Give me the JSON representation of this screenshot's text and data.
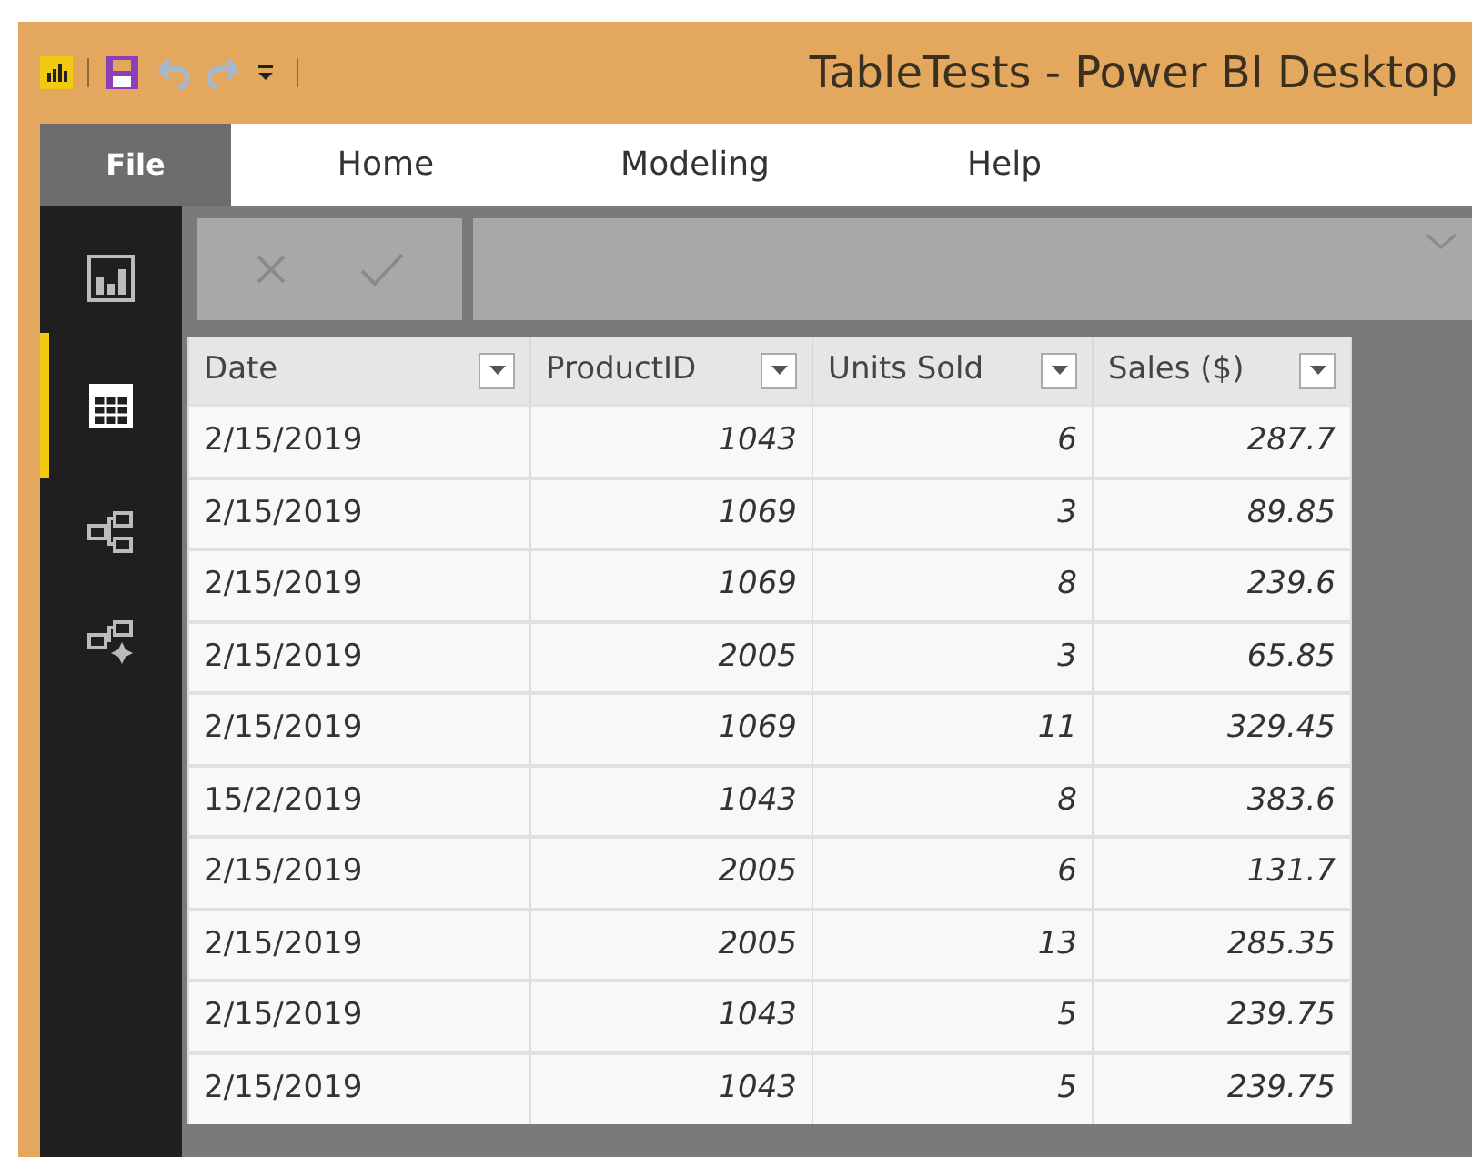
{
  "window": {
    "title": "TableTests - Power BI Desktop"
  },
  "menu": [
    {
      "label": "File",
      "selected": true
    },
    {
      "label": "Home",
      "selected": false
    },
    {
      "label": "Modeling",
      "selected": false
    },
    {
      "label": "Help",
      "selected": false
    }
  ],
  "views": [
    {
      "kind": "report",
      "selected": false
    },
    {
      "kind": "data",
      "selected": true
    },
    {
      "kind": "model",
      "selected": false
    },
    {
      "kind": "model-ai",
      "selected": false
    }
  ],
  "table": {
    "columns": [
      "Date",
      "ProductID",
      "Units Sold",
      "Sales ($)"
    ],
    "rows": [
      [
        "2/15/2019",
        "1043",
        "6",
        "287.7"
      ],
      [
        "2/15/2019",
        "1069",
        "3",
        "89.85"
      ],
      [
        "2/15/2019",
        "1069",
        "8",
        "239.6"
      ],
      [
        "2/15/2019",
        "2005",
        "3",
        "65.85"
      ],
      [
        "2/15/2019",
        "1069",
        "11",
        "329.45"
      ],
      [
        "15/2/2019",
        "1043",
        "8",
        "383.6"
      ],
      [
        "2/15/2019",
        "2005",
        "6",
        "131.7"
      ],
      [
        "2/15/2019",
        "2005",
        "13",
        "285.35"
      ],
      [
        "2/15/2019",
        "1043",
        "5",
        "239.75"
      ],
      [
        "2/15/2019",
        "1043",
        "5",
        "239.75"
      ]
    ]
  }
}
